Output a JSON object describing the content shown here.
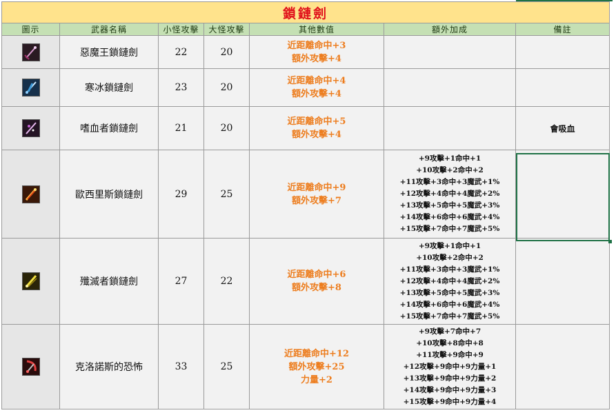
{
  "sheet": {
    "title": "鎖鏈劍"
  },
  "headers": {
    "icon": "圖示",
    "name": "武器名稱",
    "small": "小怪攻擊",
    "big": "大怪攻擊",
    "other": "其他數值",
    "extra": "額外加成",
    "note": "備註"
  },
  "rows": [
    {
      "icon": "demon-king-chain-sword-icon",
      "name": "惡魔王鎖鏈劍",
      "small": "22",
      "big": "20",
      "other": [
        "近距離命中+3",
        "額外攻擊+4"
      ],
      "extra": [],
      "note": ""
    },
    {
      "icon": "ice-chain-sword-icon",
      "name": "寒冰鎖鏈劍",
      "small": "23",
      "big": "20",
      "other": [
        "近距離命中+4",
        "額外攻擊+4"
      ],
      "extra": [],
      "note": ""
    },
    {
      "icon": "bloodthirster-chain-sword-icon",
      "name": "嗜血者鎖鏈劍",
      "small": "21",
      "big": "20",
      "other": [
        "近距離命中+5",
        "額外攻擊+4"
      ],
      "extra": [],
      "note": "會吸血"
    },
    {
      "icon": "osiris-chain-sword-icon",
      "name": "歐西里斯鎖鏈劍",
      "small": "29",
      "big": "25",
      "other": [
        "近距離命中+9",
        "額外攻擊+7"
      ],
      "extra": [
        "+9攻擊+1命中+1",
        "+10攻擊+2命中+2",
        "+11攻擊+3命中+3魔武+1%",
        "+12攻擊+4命中+4魔武+2%",
        "+13攻擊+5命中+5魔武+3%",
        "+14攻擊+6命中+6魔武+4%",
        "+15攻擊+7命中+7魔武+5%"
      ],
      "note": ""
    },
    {
      "icon": "annihilator-chain-sword-icon",
      "name": "殲滅者鎖鏈劍",
      "small": "27",
      "big": "22",
      "other": [
        "近距離命中+6",
        "額外攻擊+8"
      ],
      "extra": [
        "+9攻擊+1命中+1",
        "+10攻擊+2命中+2",
        "+11攻擊+3命中+3魔武+1%",
        "+12攻擊+4命中+4魔武+2%",
        "+13攻擊+5命中+5魔武+3%",
        "+14攻擊+6命中+6魔武+4%",
        "+15攻擊+7命中+7魔武+5%"
      ],
      "note": ""
    },
    {
      "icon": "cronus-terror-icon",
      "name": "克洛諾斯的恐怖",
      "small": "33",
      "big": "25",
      "other": [
        "近距離命中+12",
        "額外攻擊+25",
        "力量+2"
      ],
      "extra": [
        "+9攻擊+7命中+7",
        "+10攻擊+8命中+8",
        "+11攻擊+9命中+9",
        "+12攻擊+9命中+9力量+1",
        "+13攻擊+9命中+9力量+2",
        "+14攻擊+9命中+9力量+3",
        "+15攻擊+9命中+9力量+4"
      ],
      "note": ""
    }
  ],
  "colors": {
    "title_bg": "#ffe38c",
    "title_text": "#e0111b",
    "header_bg": "#c5e0b4",
    "other_text": "#ed7d1e",
    "selection": "#1e7145"
  }
}
